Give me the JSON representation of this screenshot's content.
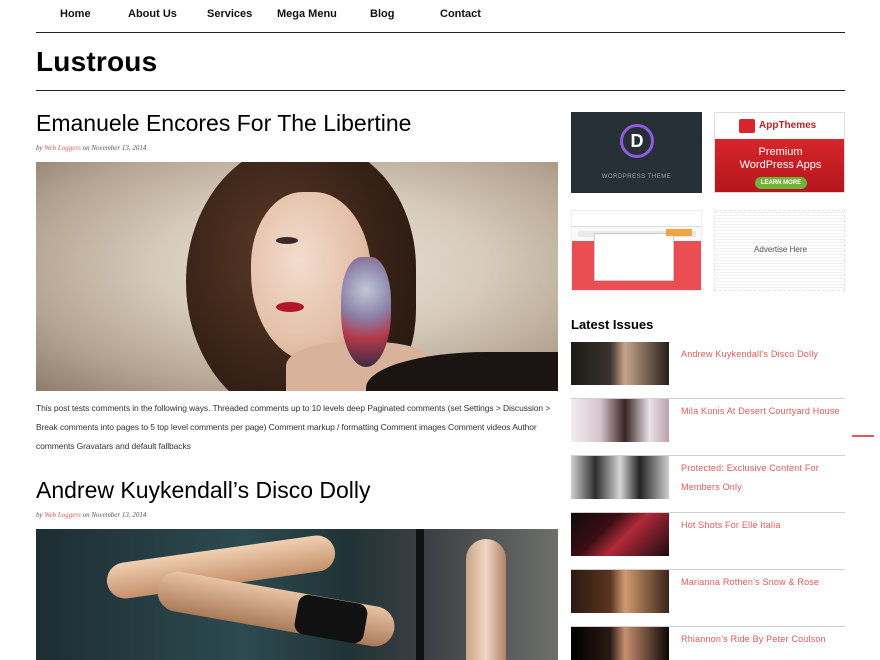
{
  "nav": {
    "items": [
      "Home",
      "About Us",
      "Services",
      "Mega Menu",
      "Blog",
      "Contact"
    ]
  },
  "site": {
    "title": "Lustrous"
  },
  "posts": [
    {
      "title": "Emanuele Encores For The Libertine",
      "meta_by": "by",
      "author": "Web Loggers",
      "meta_on": "on November 13, 2014",
      "excerpt": "This post tests comments in the following ways. Threaded comments up to 10 levels deep Paginated comments (set Settings > Discussion > Break comments into pages to 5 top level comments per page) Comment markup / formatting Comment images Comment videos Author comments Gravatars and default fallbacks"
    },
    {
      "title": "Andrew Kuykendall’s Disco Dolly",
      "meta_by": "by",
      "author": "Web Loggers",
      "meta_on": "on November 13, 2014"
    }
  ],
  "ads": {
    "divi_text": "WORDPRESS THEME",
    "appthemes_brand": "AppThemes",
    "appthemes_line1": "Premium",
    "appthemes_line2": "WordPress Apps",
    "appthemes_button": "LEARN MORE",
    "placeholder": "Advertise Here"
  },
  "sidebar": {
    "heading": "Latest Issues",
    "issues": [
      "Andrew Kuykendall’s Disco Dolly",
      "Mila Kunis At Desert Courtyard House",
      "Protected: Exclusive Content For Members Only",
      "Hot Shots For Elle Italia",
      "Marianna Rothen’s Snow & Rose",
      "Rhiannon’s Ride By Peter Coulson"
    ]
  },
  "colors": {
    "accent": "#e25a55",
    "text": "#111111",
    "rule": "#222222"
  }
}
